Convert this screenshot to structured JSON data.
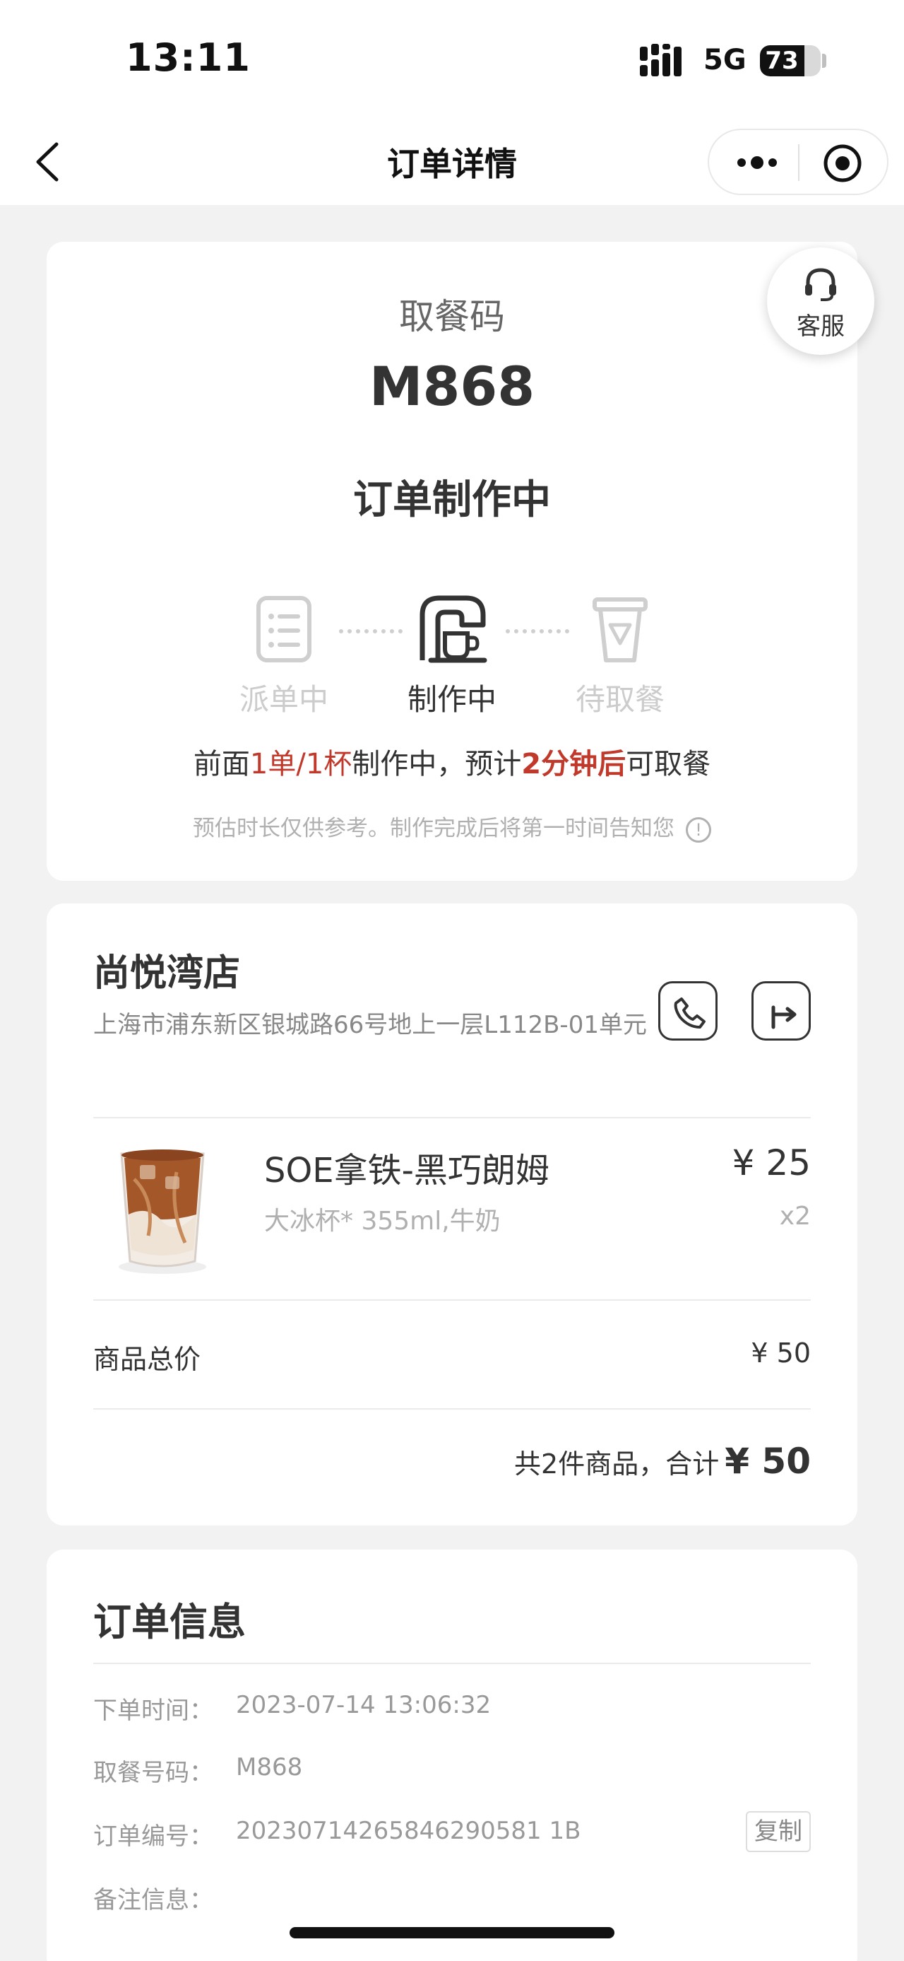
{
  "status_bar": {
    "time": "13:11",
    "network": "5G",
    "battery": "73",
    "battery_level": 0.73
  },
  "nav": {
    "title": "订单详情",
    "back_icon": "chevron-left-icon",
    "more_icon": "more-dots-icon",
    "close_icon": "target-circle-icon"
  },
  "customer_service": {
    "label": "客服",
    "icon": "headset-icon"
  },
  "pickup": {
    "label": "取餐码",
    "code": "M868",
    "status": "订单制作中",
    "steps": [
      {
        "label": "派单中",
        "icon": "order-list-icon",
        "active": false
      },
      {
        "label": "制作中",
        "icon": "coffee-machine-icon",
        "active": true
      },
      {
        "label": "待取餐",
        "icon": "cup-icon",
        "active": false
      }
    ],
    "eta": {
      "prefix": "前面",
      "queue": "1单/1杯",
      "middle": "制作中，预计",
      "time": "2分钟后",
      "suffix": "可取餐"
    },
    "note": "预估时长仅供参考。制作完成后将第一时间告知您",
    "accent_color": "#c0392b"
  },
  "store": {
    "name": "尚悦湾店",
    "address": "上海市浦东新区银城路66号地上一层L112B-01单元",
    "phone_icon": "phone-icon",
    "directions_icon": "directions-icon"
  },
  "product": {
    "name": "SOE拿铁-黑巧朗姆",
    "spec": "大冰杯* 355ml,牛奶",
    "price": "¥ 25",
    "qty": "x2",
    "image_icon": "iced-latte-image"
  },
  "totals": {
    "goods_label": "商品总价",
    "goods_value": "¥ 50",
    "summary_text": "共2件商品，合计",
    "summary_total": "¥ 50"
  },
  "order_info": {
    "title": "订单信息",
    "rows": [
      {
        "label": "下单时间：",
        "value": "2023-07-14 13:06:32"
      },
      {
        "label": "取餐号码：",
        "value": "M868"
      },
      {
        "label": "订单编号：",
        "value": "20230714265846290581 1B"
      },
      {
        "label": "备注信息：",
        "value": ""
      }
    ],
    "copy_label": "复制"
  }
}
